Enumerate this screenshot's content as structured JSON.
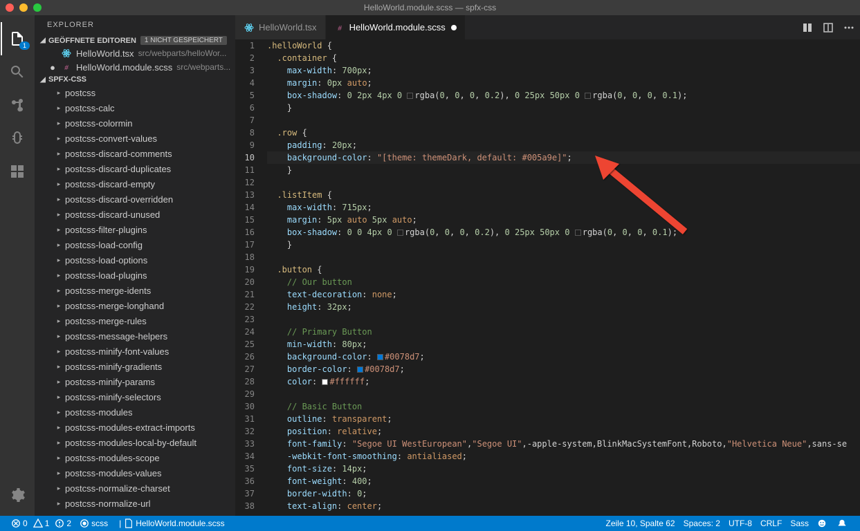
{
  "window": {
    "title": "HelloWorld.module.scss — spfx-css"
  },
  "sidebar": {
    "title": "EXPLORER",
    "open_editors_label": "GEÖFFNETE EDITOREN",
    "unsaved_label": "1 NICHT GESPEICHERT",
    "project_label": "SPFX-CSS",
    "open_editors": [
      {
        "name": "HelloWorld.tsx",
        "path": "src/webparts/helloWor...",
        "dirty": false,
        "icon": "react"
      },
      {
        "name": "HelloWorld.module.scss",
        "path": "src/webparts...",
        "dirty": true,
        "icon": "scss"
      }
    ],
    "tree": [
      "postcss",
      "postcss-calc",
      "postcss-colormin",
      "postcss-convert-values",
      "postcss-discard-comments",
      "postcss-discard-duplicates",
      "postcss-discard-empty",
      "postcss-discard-overridden",
      "postcss-discard-unused",
      "postcss-filter-plugins",
      "postcss-load-config",
      "postcss-load-options",
      "postcss-load-plugins",
      "postcss-merge-idents",
      "postcss-merge-longhand",
      "postcss-merge-rules",
      "postcss-message-helpers",
      "postcss-minify-font-values",
      "postcss-minify-gradients",
      "postcss-minify-params",
      "postcss-minify-selectors",
      "postcss-modules",
      "postcss-modules-extract-imports",
      "postcss-modules-local-by-default",
      "postcss-modules-scope",
      "postcss-modules-values",
      "postcss-normalize-charset",
      "postcss-normalize-url"
    ]
  },
  "tabs": [
    {
      "label": "HelloWorld.tsx",
      "active": false,
      "dirty": false,
      "icon": "react"
    },
    {
      "label": "HelloWorld.module.scss",
      "active": true,
      "dirty": true,
      "icon": "scss"
    }
  ],
  "activity_badge": "1",
  "statusbar": {
    "errors": "0",
    "warnings": "1",
    "infos": "2",
    "lang_mode": "scss",
    "file": "HelloWorld.module.scss",
    "cursor": "Zeile 10, Spalte 62",
    "spaces": "Spaces: 2",
    "encoding": "UTF-8",
    "eol": "CRLF",
    "lang_name": "Sass"
  },
  "code": {
    "current_line": 10,
    "lines": [
      {
        "sel": ".helloWorld",
        "rest": " {"
      },
      {
        "ind": 1,
        "sel": ".container",
        "rest": " {"
      },
      {
        "ind": 2,
        "prop": "max-width",
        "val_num": "700px",
        "end": ";"
      },
      {
        "ind": 2,
        "prop": "margin",
        "raw": [
          ": ",
          {
            "n": "0px"
          },
          " ",
          {
            "k": "auto"
          },
          ";"
        ]
      },
      {
        "ind": 2,
        "prop": "box-shadow",
        "raw": [
          ": ",
          {
            "n": "0"
          },
          " ",
          {
            "n": "2px"
          },
          " ",
          {
            "n": "4px"
          },
          " ",
          {
            "n": "0"
          },
          " ",
          {
            "sw": "transparent"
          },
          "rgba(",
          {
            "n": "0"
          },
          ", ",
          {
            "n": "0"
          },
          ", ",
          {
            "n": "0"
          },
          ", ",
          {
            "n": "0.2"
          },
          "), ",
          {
            "n": "0"
          },
          " ",
          {
            "n": "25px"
          },
          " ",
          {
            "n": "50px"
          },
          " ",
          {
            "n": "0"
          },
          " ",
          {
            "sw": "transparent"
          },
          "rgba(",
          {
            "n": "0"
          },
          ", ",
          {
            "n": "0"
          },
          ", ",
          {
            "n": "0"
          },
          ", ",
          {
            "n": "0.1"
          },
          ");"
        ]
      },
      {
        "ind": 2,
        "close": "}"
      },
      {
        "blank": true
      },
      {
        "ind": 1,
        "sel": ".row",
        "rest": " {"
      },
      {
        "ind": 2,
        "prop": "padding",
        "val_num": "20px",
        "end": ";"
      },
      {
        "ind": 2,
        "prop": "background-color",
        "raw": [
          ": ",
          {
            "s": "\"[theme: themeDark, default: #005a9e]\""
          },
          ";"
        ]
      },
      {
        "ind": 2,
        "close": "}"
      },
      {
        "blank": true
      },
      {
        "ind": 1,
        "sel": ".listItem",
        "rest": " {"
      },
      {
        "ind": 2,
        "prop": "max-width",
        "val_num": "715px",
        "end": ";"
      },
      {
        "ind": 2,
        "prop": "margin",
        "raw": [
          ": ",
          {
            "n": "5px"
          },
          " ",
          {
            "k": "auto"
          },
          " ",
          {
            "n": "5px"
          },
          " ",
          {
            "k": "auto"
          },
          ";"
        ]
      },
      {
        "ind": 2,
        "prop": "box-shadow",
        "raw": [
          ": ",
          {
            "n": "0"
          },
          " ",
          {
            "n": "0"
          },
          " ",
          {
            "n": "4px"
          },
          " ",
          {
            "n": "0"
          },
          " ",
          {
            "sw": "transparent"
          },
          "rgba(",
          {
            "n": "0"
          },
          ", ",
          {
            "n": "0"
          },
          ", ",
          {
            "n": "0"
          },
          ", ",
          {
            "n": "0.2"
          },
          "), ",
          {
            "n": "0"
          },
          " ",
          {
            "n": "25px"
          },
          " ",
          {
            "n": "50px"
          },
          " ",
          {
            "n": "0"
          },
          " ",
          {
            "sw": "transparent"
          },
          "rgba(",
          {
            "n": "0"
          },
          ", ",
          {
            "n": "0"
          },
          ", ",
          {
            "n": "0"
          },
          ", ",
          {
            "n": "0.1"
          },
          ");"
        ]
      },
      {
        "ind": 2,
        "close": "}"
      },
      {
        "blank": true
      },
      {
        "ind": 1,
        "sel": ".button",
        "rest": " {"
      },
      {
        "ind": 2,
        "comment": "// Our button"
      },
      {
        "ind": 2,
        "prop": "text-decoration",
        "raw": [
          ": ",
          {
            "k": "none"
          },
          ";"
        ]
      },
      {
        "ind": 2,
        "prop": "height",
        "val_num": "32px",
        "end": ";"
      },
      {
        "blank": true
      },
      {
        "ind": 2,
        "comment": "// Primary Button"
      },
      {
        "ind": 2,
        "prop": "min-width",
        "val_num": "80px",
        "end": ";"
      },
      {
        "ind": 2,
        "prop": "background-color",
        "raw": [
          ": ",
          {
            "sw": "#0078d7"
          },
          {
            "h": "#0078d7"
          },
          ";"
        ]
      },
      {
        "ind": 2,
        "prop": "border-color",
        "raw": [
          ": ",
          {
            "sw": "#0078d7"
          },
          {
            "h": "#0078d7"
          },
          ";"
        ]
      },
      {
        "ind": 2,
        "prop": "color",
        "raw": [
          ": ",
          {
            "sw": "#ffffff"
          },
          {
            "h": "#ffffff"
          },
          ";"
        ]
      },
      {
        "blank": true
      },
      {
        "ind": 2,
        "comment": "// Basic Button"
      },
      {
        "ind": 2,
        "prop": "outline",
        "raw": [
          ": ",
          {
            "k": "transparent"
          },
          ";"
        ]
      },
      {
        "ind": 2,
        "prop": "position",
        "raw": [
          ": ",
          {
            "k": "relative"
          },
          ";"
        ]
      },
      {
        "ind": 2,
        "prop": "font-family",
        "raw": [
          ": ",
          {
            "s": "\"Segoe UI WestEuropean\""
          },
          ",",
          {
            "s": "\"Segoe UI\""
          },
          ",-apple-system,BlinkMacSystemFont,Roboto,",
          {
            "s": "\"Helvetica Neue\""
          },
          ",sans-se"
        ]
      },
      {
        "ind": 2,
        "prop": "-webkit-font-smoothing",
        "raw": [
          ": ",
          {
            "k": "antialiased"
          },
          ";"
        ]
      },
      {
        "ind": 2,
        "prop": "font-size",
        "val_num": "14px",
        "end": ";"
      },
      {
        "ind": 2,
        "prop": "font-weight",
        "val_num": "400",
        "end": ";"
      },
      {
        "ind": 2,
        "prop": "border-width",
        "val_num": "0",
        "end": ";"
      },
      {
        "ind": 2,
        "prop": "text-align",
        "raw": [
          ": ",
          {
            "k": "center"
          },
          ";"
        ]
      }
    ]
  }
}
